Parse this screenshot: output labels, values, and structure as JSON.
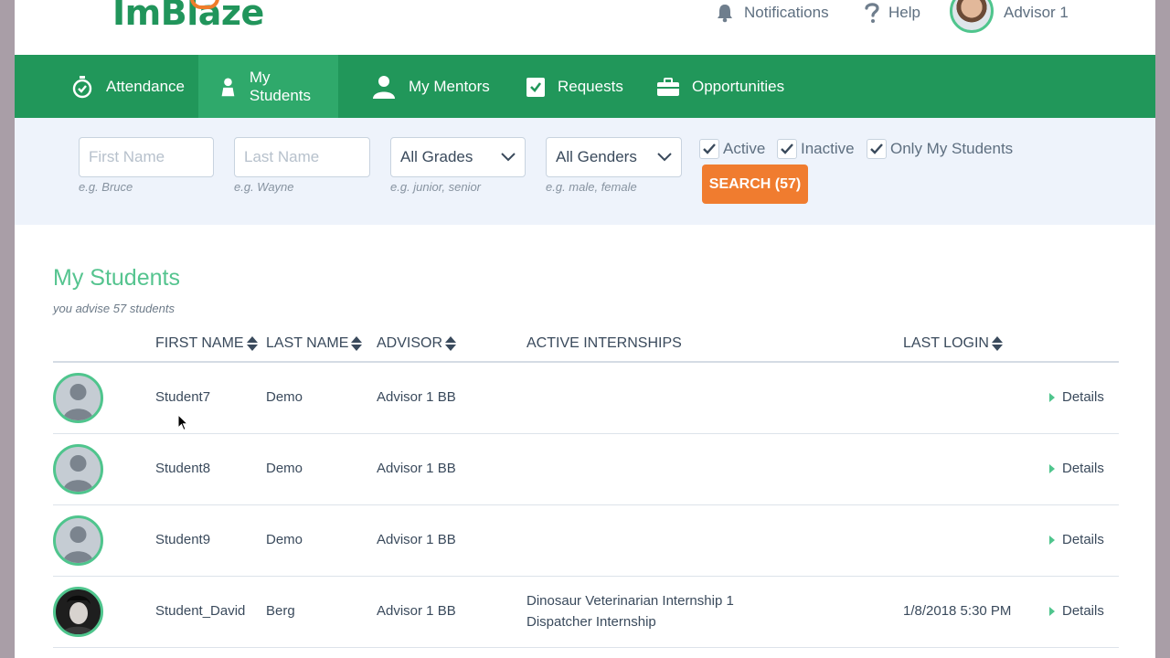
{
  "brand": {
    "logo_text": "ImBlaze",
    "accent": "#21975a",
    "orange": "#f07c2f"
  },
  "top_links": {
    "notifications": "Notifications",
    "help": "Help",
    "user": "Advisor 1"
  },
  "nav": {
    "items": [
      {
        "label": "Attendance",
        "icon": "stopwatch-icon",
        "active": false
      },
      {
        "label": "My Students",
        "icon": "student-icon",
        "active": true
      },
      {
        "label": "My Mentors",
        "icon": "mentor-icon",
        "active": false
      },
      {
        "label": "Requests",
        "icon": "checkbox-icon",
        "active": false
      },
      {
        "label": "Opportunities",
        "icon": "briefcase-icon",
        "active": false
      }
    ]
  },
  "filters": {
    "first_name": {
      "placeholder": "First Name",
      "hint": "e.g. Bruce"
    },
    "last_name": {
      "placeholder": "Last Name",
      "hint": "e.g. Wayne"
    },
    "grades": {
      "value": "All Grades",
      "hint": "e.g. junior, senior"
    },
    "genders": {
      "value": "All Genders",
      "hint": "e.g. male, female"
    },
    "checkboxes": [
      {
        "label": "Active",
        "checked": true
      },
      {
        "label": "Inactive",
        "checked": true
      },
      {
        "label": "Only My Students",
        "checked": true
      }
    ],
    "search_label": "SEARCH (57)"
  },
  "main": {
    "title": "My Students",
    "subtitle": "you advise 57 students",
    "columns": {
      "first_name": "FIRST NAME",
      "last_name": "LAST NAME",
      "advisor": "ADVISOR",
      "internships": "ACTIVE INTERNSHIPS",
      "last_login": "LAST LOGIN"
    },
    "rows": [
      {
        "first": "Student7",
        "last": "Demo",
        "advisor": "Advisor 1 BB",
        "internships": [
          "",
          ""
        ],
        "login": "",
        "details": "Details"
      },
      {
        "first": "Student8",
        "last": "Demo",
        "advisor": "Advisor 1 BB",
        "internships": [
          "",
          ""
        ],
        "login": "",
        "details": "Details"
      },
      {
        "first": "Student9",
        "last": "Demo",
        "advisor": "Advisor 1 BB",
        "internships": [
          "",
          ""
        ],
        "login": "",
        "details": "Details"
      },
      {
        "first": "Student_David",
        "last": "Berg",
        "advisor": "Advisor 1 BB",
        "internships": [
          "Dinosaur Veterinarian Internship 1",
          "Dispatcher Internship"
        ],
        "login": "1/8/2018 5:30 PM",
        "details": "Details"
      }
    ]
  }
}
